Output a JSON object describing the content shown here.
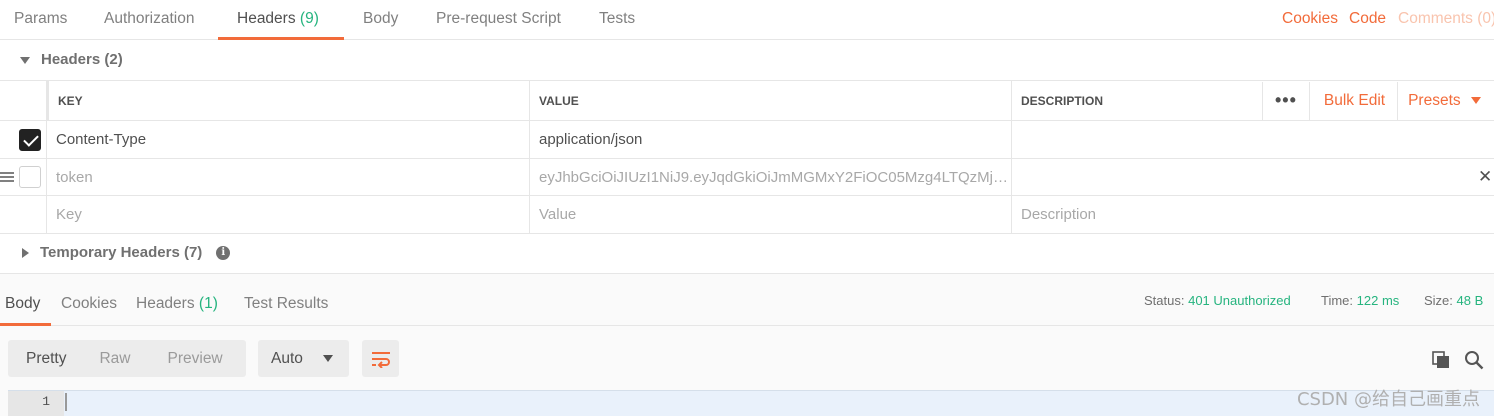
{
  "request_tabs": {
    "params": "Params",
    "authorization": "Authorization",
    "headers": "Headers",
    "headers_count": "(9)",
    "body": "Body",
    "prerequest": "Pre-request Script",
    "tests": "Tests"
  },
  "right_links": {
    "cookies": "Cookies",
    "code": "Code",
    "comments": "Comments (0)"
  },
  "headers_section": {
    "title": "Headers",
    "count": "(2)"
  },
  "table": {
    "columns": {
      "key": "KEY",
      "value": "VALUE",
      "description": "DESCRIPTION"
    },
    "actions": {
      "more": "•••",
      "bulk_edit": "Bulk Edit",
      "presets": "Presets"
    },
    "rows": [
      {
        "key": "Content-Type",
        "value": "application/json",
        "description": "",
        "checked": true
      },
      {
        "key": "token",
        "value": "eyJhbGciOiJIUzI1NiJ9.eyJqdGkiOiJmMGMxY2FiOC05Mzg4LTQzMj…",
        "description": "",
        "checked": false
      }
    ],
    "placeholder": {
      "key": "Key",
      "value": "Value",
      "description": "Description"
    }
  },
  "temporary_headers": {
    "title": "Temporary Headers",
    "count": "(7)",
    "info": "i"
  },
  "response_tabs": {
    "body": "Body",
    "cookies": "Cookies",
    "headers": "Headers",
    "headers_count": "(1)",
    "test_results": "Test Results"
  },
  "response_status": {
    "status_label": "Status:",
    "status_value": "401 Unauthorized",
    "time_label": "Time:",
    "time_value": "122 ms",
    "size_label": "Size:",
    "size_value": "48 B"
  },
  "view_modes": {
    "pretty": "Pretty",
    "raw": "Raw",
    "preview": "Preview"
  },
  "format_select": {
    "selected": "Auto"
  },
  "editor": {
    "line_number": "1"
  },
  "watermark": "CSDN @给自己画重点",
  "colors": {
    "accent": "#f26b3a",
    "success": "#26b47f"
  }
}
